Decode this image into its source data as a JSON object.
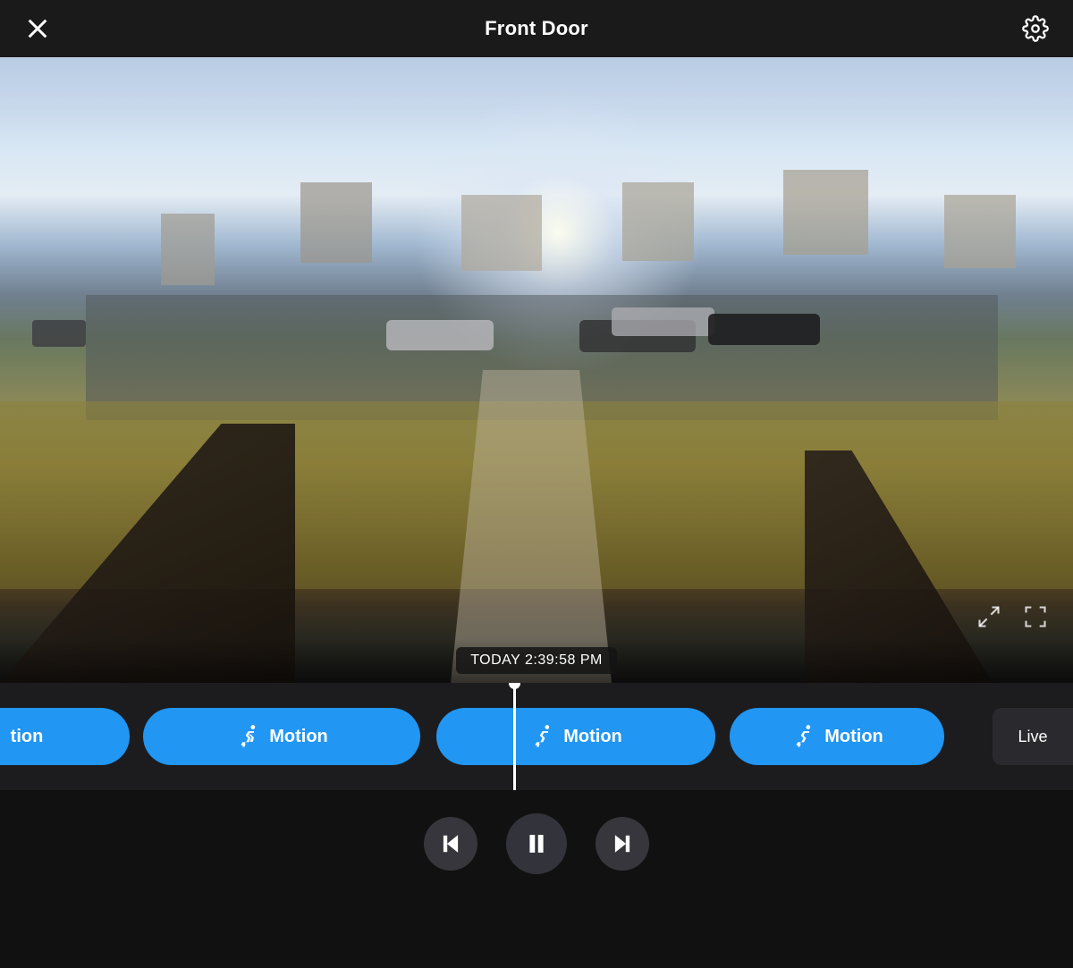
{
  "header": {
    "title": "Front Door",
    "close_label": "Close",
    "settings_label": "Settings"
  },
  "video": {
    "timestamp": "TODAY 2:39:58 PM",
    "expand_label": "Expand",
    "fullscreen_label": "Fullscreen"
  },
  "timeline": {
    "events": [
      {
        "id": "event-1",
        "label": "tion",
        "type": "motion",
        "has_icon": false
      },
      {
        "id": "event-2",
        "label": "Motion",
        "type": "motion",
        "has_icon": true
      },
      {
        "id": "event-3",
        "label": "Motion",
        "type": "motion",
        "has_icon": true
      },
      {
        "id": "event-4",
        "label": "Motion",
        "type": "motion",
        "has_icon": true
      }
    ],
    "live_label": "Live"
  },
  "controls": {
    "previous_label": "Previous",
    "pause_label": "Pause",
    "next_label": "Next"
  }
}
